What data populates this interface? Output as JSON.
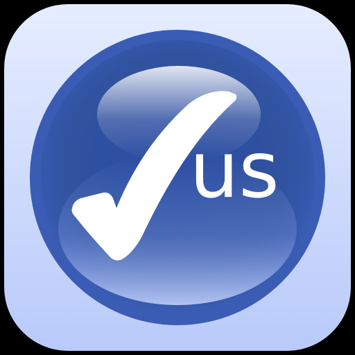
{
  "app_icon": {
    "logo_text": "us",
    "icon": "checkmark-icon",
    "colors": {
      "background": "#000000",
      "tile_light": "#e4ebff",
      "tile_dark": "#bccdfb",
      "ring": "#3a5cb4",
      "orb_center": "#2d4fa6",
      "orb_edge": "#6f8ad6",
      "mark": "#ffffff"
    }
  }
}
